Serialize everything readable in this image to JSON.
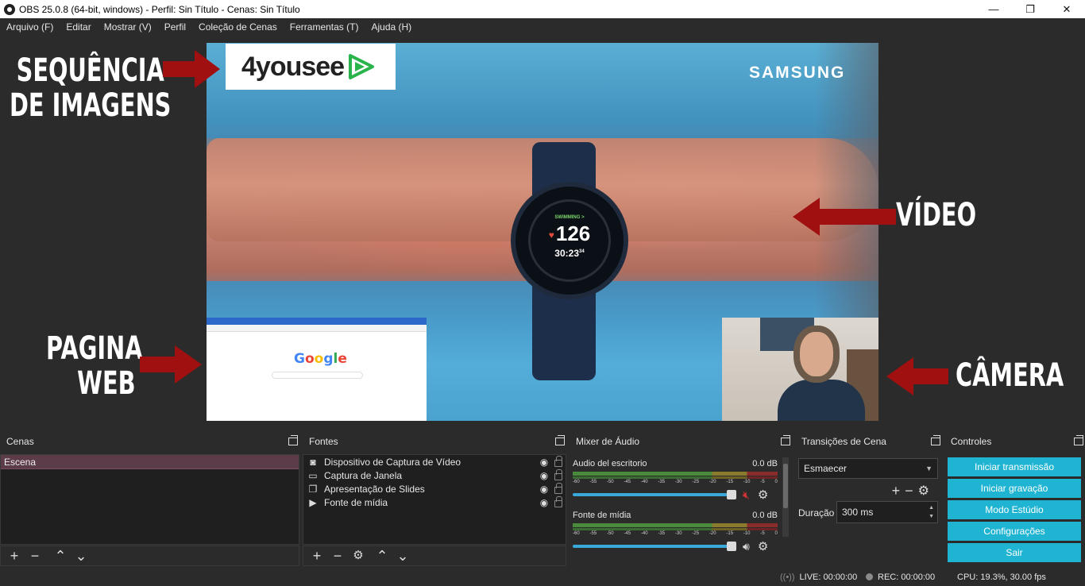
{
  "window": {
    "title": "OBS 25.0.8 (64-bit, windows) - Perfil: Sin Título - Cenas: Sin Título",
    "minimize": "—",
    "maximize": "❐",
    "close": "✕"
  },
  "menu": [
    "Arquivo (F)",
    "Editar",
    "Mostrar (V)",
    "Perfil",
    "Coleção de Cenas",
    "Ferramentas (T)",
    "Ajuda (H)"
  ],
  "preview": {
    "logo_text": "4yousee",
    "brand_text": "SAMSUNG",
    "watch": {
      "mode": "SWIMMING >",
      "bpm": "126",
      "time": "30:23",
      "time_sup": "34"
    },
    "google_logo": "Google",
    "annotations": {
      "sequence_line1": "SEQUÊNCIA",
      "sequence_line2": "DE IMAGENS",
      "video": "VÍDEO",
      "web_line1": "PAGINA",
      "web_line2": "WEB",
      "camera": "CÂMERA"
    },
    "accent_arrow": "#a01010"
  },
  "docks": {
    "scenes": {
      "title": "Cenas",
      "items": [
        "Escena"
      ]
    },
    "sources": {
      "title": "Fontes",
      "items": [
        {
          "label": "Dispositivo de Captura de Vídeo",
          "icon": "camera-icon"
        },
        {
          "label": "Captura de Janela",
          "icon": "window-icon"
        },
        {
          "label": "Apresentação de Slides",
          "icon": "slides-icon"
        },
        {
          "label": "Fonte de mídia",
          "icon": "play-icon"
        }
      ]
    },
    "mixer": {
      "title": "Mixer de Áudio",
      "ticks": [
        "-60",
        "-55",
        "-50",
        "-45",
        "-40",
        "-35",
        "-30",
        "-25",
        "-20",
        "-15",
        "-10",
        "-5",
        "0"
      ],
      "channels": [
        {
          "name": "Audio del escritorio",
          "db": "0.0 dB",
          "muted": true
        },
        {
          "name": "Fonte de mídia",
          "db": "0.0 dB",
          "muted": false
        }
      ]
    },
    "transitions": {
      "title": "Transições de Cena",
      "selected": "Esmaecer",
      "duration_label": "Duração",
      "duration_value": "300 ms"
    },
    "controls": {
      "title": "Controles",
      "buttons": [
        "Iniciar transmissão",
        "Iniciar gravação",
        "Modo Estúdio",
        "Configurações",
        "Sair"
      ],
      "accent": "#1fb4d2"
    }
  },
  "status": {
    "live": "LIVE: 00:00:00",
    "rec": "REC: 00:00:00",
    "cpu": "CPU: 19.3%, 30.00 fps"
  }
}
